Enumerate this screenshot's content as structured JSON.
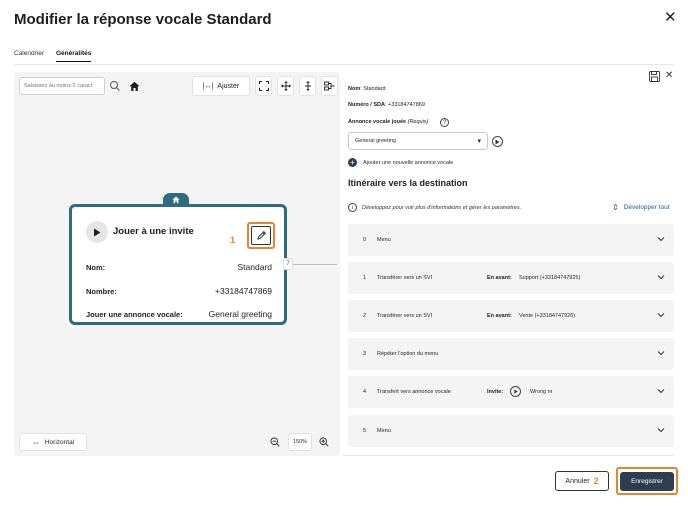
{
  "dialog": {
    "title": "Modifier la réponse vocale Standard",
    "close_icon": "close-icon"
  },
  "tabs": [
    {
      "label": "Calendrier",
      "active": false
    },
    {
      "label": "Généralités",
      "active": true
    }
  ],
  "canvas": {
    "search_placeholder": "Saisissez au moins 2 caract",
    "toolbar": {
      "ajuster_label": "Ajuster"
    },
    "card": {
      "title": "Jouer à une invite",
      "step_marker": "1",
      "rows": [
        {
          "label": "Nom:",
          "value": "Standard"
        },
        {
          "label": "Nombre:",
          "value": "+33184747869"
        },
        {
          "label": "Jouer une annonce vocale:",
          "value": "General greeting"
        }
      ]
    },
    "port_label": "7",
    "horizontal_label": "Horizontal",
    "zoom_level": "150%"
  },
  "panel": {
    "nom_label": "Nom",
    "nom_value": "Standard",
    "sda_label": "Numéro / SDA",
    "sda_value": "+33184747869",
    "annonce_label": "Annonce vocale jouée",
    "annonce_required": "(Requis)",
    "select_value": "General greeting",
    "add_label": "Ajouter une nouvelle annonce vocale",
    "itinerary_title": "Itinéraire vers la destination",
    "info_text": "Développez pour voir plus d'informations et gérer les paramètres.",
    "develop_all": "Développer tout",
    "items": [
      {
        "num": "0",
        "label": "Menu",
        "key": "",
        "value": ""
      },
      {
        "num": "1",
        "label": "Transférer vers un SVI",
        "key": "En avant:",
        "value": "Support (+33184747925)"
      },
      {
        "num": "2",
        "label": "Transférer vers un SVI",
        "key": "En avant:",
        "value": "Vente (+33184747926)"
      },
      {
        "num": "3",
        "label": "Répéter l'option du menu",
        "key": "",
        "value": ""
      },
      {
        "num": "4",
        "label": "Transfert vers annonce vocale",
        "key": "Invite:",
        "value": "Wrong nr"
      },
      {
        "num": "5",
        "label": "Menu",
        "key": "",
        "value": ""
      }
    ]
  },
  "footer": {
    "cancel_label": "Annuler",
    "cancel_marker": "2",
    "save_label": "Enregistrer"
  },
  "colors": {
    "card_border": "#2c6b80",
    "highlight": "#e8852c",
    "primary_button": "#2c3e50"
  }
}
